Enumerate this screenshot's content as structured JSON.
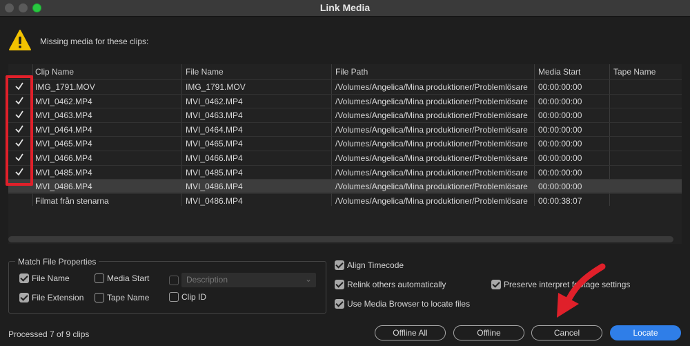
{
  "window": {
    "title": "Link Media"
  },
  "header": {
    "message": "Missing media for these clips:",
    "icon": "warning-icon"
  },
  "table": {
    "columns": [
      "Clip Name",
      "File Name",
      "File Path",
      "Media Start",
      "Tape Name"
    ],
    "rows": [
      {
        "checked": true,
        "clip": "IMG_1791.MOV",
        "file": "IMG_1791.MOV",
        "path": "/Volumes/Angelica/Mina produktioner/Problemlösare",
        "start": "00:00:00:00",
        "tape": ""
      },
      {
        "checked": true,
        "clip": "MVI_0462.MP4",
        "file": "MVI_0462.MP4",
        "path": "/Volumes/Angelica/Mina produktioner/Problemlösare",
        "start": "00:00:00:00",
        "tape": ""
      },
      {
        "checked": true,
        "clip": "MVI_0463.MP4",
        "file": "MVI_0463.MP4",
        "path": "/Volumes/Angelica/Mina produktioner/Problemlösare",
        "start": "00:00:00:00",
        "tape": ""
      },
      {
        "checked": true,
        "clip": "MVI_0464.MP4",
        "file": "MVI_0464.MP4",
        "path": "/Volumes/Angelica/Mina produktioner/Problemlösare",
        "start": "00:00:00:00",
        "tape": ""
      },
      {
        "checked": true,
        "clip": "MVI_0465.MP4",
        "file": "MVI_0465.MP4",
        "path": "/Volumes/Angelica/Mina produktioner/Problemlösare",
        "start": "00:00:00:00",
        "tape": ""
      },
      {
        "checked": true,
        "clip": "MVI_0466.MP4",
        "file": "MVI_0466.MP4",
        "path": "/Volumes/Angelica/Mina produktioner/Problemlösare",
        "start": "00:00:00:00",
        "tape": ""
      },
      {
        "checked": true,
        "clip": "MVI_0485.MP4",
        "file": "MVI_0485.MP4",
        "path": "/Volumes/Angelica/Mina produktioner/Problemlösare",
        "start": "00:00:00:00",
        "tape": ""
      },
      {
        "checked": false,
        "clip": "MVI_0486.MP4",
        "file": "MVI_0486.MP4",
        "path": "/Volumes/Angelica/Mina produktioner/Problemlösare",
        "start": "00:00:00:00",
        "tape": "",
        "selected": true
      },
      {
        "checked": false,
        "clip": "Filmat från stenarna",
        "file": "MVI_0486.MP4",
        "path": "/Volumes/Angelica/Mina produktioner/Problemlösare",
        "start": "00:00:38:07",
        "tape": ""
      }
    ]
  },
  "match_properties": {
    "title": "Match File Properties",
    "file_name": {
      "label": "File Name",
      "checked": true
    },
    "media_start": {
      "label": "Media Start",
      "checked": false
    },
    "description": {
      "label": "Description",
      "checked": false,
      "disabled": true
    },
    "file_extension": {
      "label": "File Extension",
      "checked": true
    },
    "tape_name": {
      "label": "Tape Name",
      "checked": false
    },
    "clip_id": {
      "label": "Clip ID",
      "checked": false
    }
  },
  "options": {
    "align_timecode": {
      "label": "Align Timecode",
      "checked": true
    },
    "relink_others": {
      "label": "Relink others automatically",
      "checked": true
    },
    "preserve_interpret": {
      "label": "Preserve interpret footage settings",
      "checked": true
    },
    "use_media_browser": {
      "label": "Use Media Browser to locate files",
      "checked": true
    }
  },
  "status": {
    "text": "Processed 7 of 9 clips"
  },
  "buttons": {
    "offline_all": "Offline All",
    "offline": "Offline",
    "cancel": "Cancel",
    "locate": "Locate"
  },
  "colors": {
    "accent": "#2f7ee8",
    "annotation": "#e0202a"
  }
}
